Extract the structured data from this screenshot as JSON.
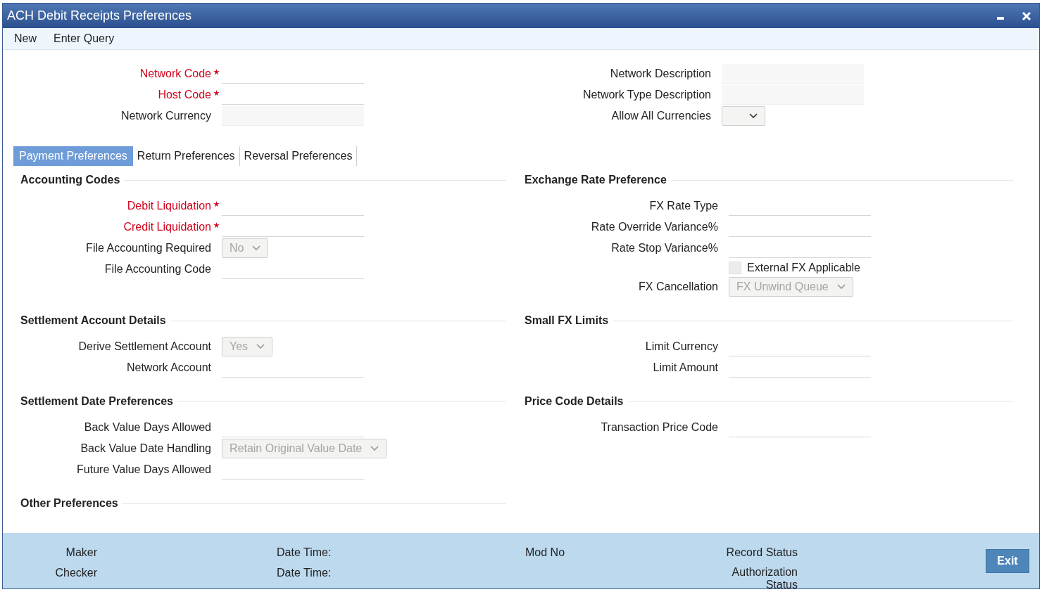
{
  "window": {
    "title": "ACH Debit Receipts Preferences"
  },
  "toolbar": [
    {
      "label": "New"
    },
    {
      "label": "Enter Query"
    }
  ],
  "header": {
    "left": {
      "fields": [
        {
          "label": "Network Code",
          "required": true,
          "kind": "text"
        },
        {
          "label": "Host Code",
          "required": true,
          "kind": "text"
        },
        {
          "label": "Network Currency",
          "required": false,
          "kind": "readonly"
        }
      ]
    },
    "right": {
      "fields": [
        {
          "label": "Network Description",
          "required": false,
          "kind": "readonly"
        },
        {
          "label": "Network Type Description",
          "required": false,
          "kind": "readonly"
        },
        {
          "label": "Allow All Currencies",
          "required": false,
          "kind": "select",
          "disabled": false
        }
      ]
    }
  },
  "tabs": [
    {
      "label": "Payment Preferences",
      "selected": true
    },
    {
      "label": "Return Preferences",
      "selected": false
    },
    {
      "label": "Reversal Preferences",
      "selected": false
    }
  ],
  "section_rows": [
    {
      "left": {
        "title": "Accounting Codes",
        "fields": [
          {
            "label": "Debit Liquidation",
            "required": true,
            "kind": "text"
          },
          {
            "label": "Credit Liquidation",
            "required": true,
            "kind": "text"
          },
          {
            "label": "File Accounting Required",
            "required": false,
            "kind": "select",
            "value": "No",
            "disabled": true
          },
          {
            "label": "File Accounting Code",
            "required": false,
            "kind": "text"
          }
        ]
      },
      "right": {
        "title": "Exchange Rate Preference",
        "fields": [
          {
            "label": "FX Rate Type",
            "required": false,
            "kind": "text"
          },
          {
            "label": "Rate Override Variance%",
            "required": false,
            "kind": "text"
          },
          {
            "label": "Rate Stop Variance%",
            "required": false,
            "kind": "text"
          },
          {
            "label": "External FX Applicable",
            "kind": "checkbox",
            "checked": false,
            "disabled": true
          },
          {
            "label": "FX Cancellation",
            "required": false,
            "kind": "select",
            "value": "FX Unwind Queue",
            "disabled": true
          }
        ]
      }
    },
    {
      "left": {
        "title": "Settlement Account Details",
        "fields": [
          {
            "label": "Derive Settlement Account",
            "required": false,
            "kind": "select",
            "value": "Yes",
            "disabled": true
          },
          {
            "label": "Network Account",
            "required": false,
            "kind": "text"
          }
        ]
      },
      "right": {
        "title": "Small FX Limits",
        "fields": [
          {
            "label": "Limit Currency",
            "required": false,
            "kind": "text"
          },
          {
            "label": "Limit Amount",
            "required": false,
            "kind": "text"
          }
        ]
      }
    },
    {
      "left": {
        "title": "Settlement Date Preferences",
        "fields": [
          {
            "label": "Back Value Days Allowed",
            "required": false,
            "kind": "text"
          },
          {
            "label": "Back Value Date Handling",
            "required": false,
            "kind": "select",
            "value": "Retain Original Value Date",
            "disabled": true
          },
          {
            "label": "Future Value Days Allowed",
            "required": false,
            "kind": "text"
          }
        ]
      },
      "right": {
        "title": "Price Code Details",
        "fields": [
          {
            "label": "Transaction Price Code",
            "required": false,
            "kind": "text"
          }
        ]
      }
    },
    {
      "left": {
        "title": "Other Preferences"
      }
    }
  ],
  "footer": {
    "columns": [
      {
        "items": [
          "Maker",
          "Checker"
        ]
      },
      {
        "items": [
          "Date Time:",
          "Date Time:"
        ]
      },
      {
        "items": [
          "Mod No"
        ]
      },
      {
        "items": [
          "Record Status",
          "Authorization Status"
        ]
      }
    ],
    "exit_button": "Exit"
  }
}
